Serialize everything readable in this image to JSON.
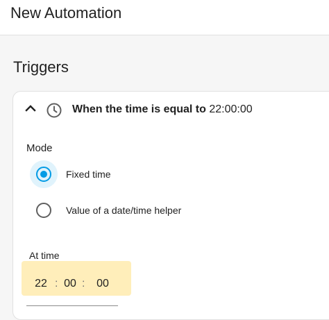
{
  "app": {
    "title": "New Automation"
  },
  "section": {
    "title": "Triggers"
  },
  "trigger": {
    "summary_prefix": "When the time is equal to ",
    "summary_time": "22:00:00",
    "icons": {
      "collapse": "chevron-up-icon",
      "type": "clock-icon"
    }
  },
  "mode": {
    "label": "Mode",
    "options": [
      {
        "label": "Fixed time",
        "selected": true
      },
      {
        "label": "Value of a date/time helper",
        "selected": false
      }
    ]
  },
  "at_time": {
    "label": "At time",
    "hours": "22",
    "minutes": "00",
    "seconds": "00",
    "separator": ":"
  },
  "colors": {
    "accent": "#039be5",
    "highlight": "#ffe082",
    "background": "#f6f6f6"
  }
}
